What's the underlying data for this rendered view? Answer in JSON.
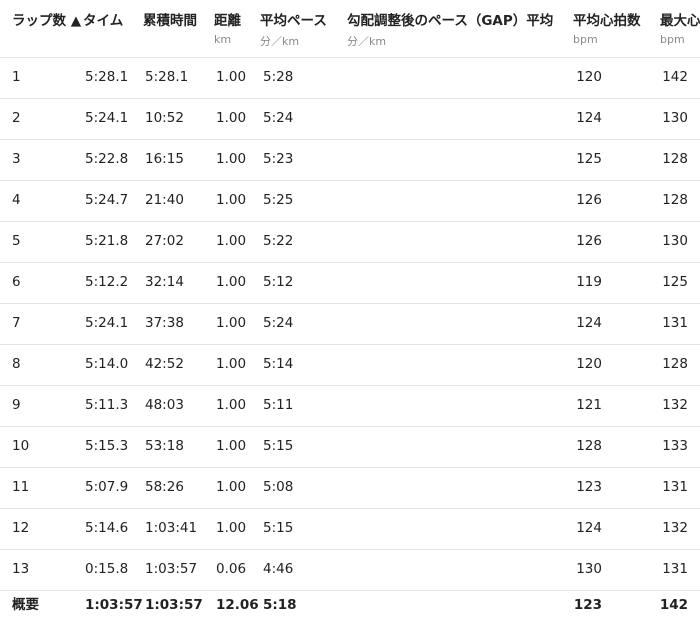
{
  "headers": [
    {
      "label": "ラップ数 ▲",
      "unit": ""
    },
    {
      "label": "タイム",
      "unit": ""
    },
    {
      "label": "累積時間",
      "unit": ""
    },
    {
      "label": "距離",
      "unit": "km"
    },
    {
      "label": "平均ペース",
      "unit": "分／km"
    },
    {
      "label": "勾配調整後のペース（GAP）平均",
      "unit": "分／km"
    },
    {
      "label": "平均心拍数",
      "unit": "bpm"
    },
    {
      "label": "最大心",
      "unit": "bpm"
    }
  ],
  "rows": [
    {
      "lap": "1",
      "time": "5:28.1",
      "cumulative": "5:28.1",
      "distance": "1.00",
      "pace": "5:28",
      "gap": "",
      "avg_hr": "120",
      "max_hr": "142"
    },
    {
      "lap": "2",
      "time": "5:24.1",
      "cumulative": "10:52",
      "distance": "1.00",
      "pace": "5:24",
      "gap": "",
      "avg_hr": "124",
      "max_hr": "130"
    },
    {
      "lap": "3",
      "time": "5:22.8",
      "cumulative": "16:15",
      "distance": "1.00",
      "pace": "5:23",
      "gap": "",
      "avg_hr": "125",
      "max_hr": "128"
    },
    {
      "lap": "4",
      "time": "5:24.7",
      "cumulative": "21:40",
      "distance": "1.00",
      "pace": "5:25",
      "gap": "",
      "avg_hr": "126",
      "max_hr": "128"
    },
    {
      "lap": "5",
      "time": "5:21.8",
      "cumulative": "27:02",
      "distance": "1.00",
      "pace": "5:22",
      "gap": "",
      "avg_hr": "126",
      "max_hr": "130"
    },
    {
      "lap": "6",
      "time": "5:12.2",
      "cumulative": "32:14",
      "distance": "1.00",
      "pace": "5:12",
      "gap": "",
      "avg_hr": "119",
      "max_hr": "125"
    },
    {
      "lap": "7",
      "time": "5:24.1",
      "cumulative": "37:38",
      "distance": "1.00",
      "pace": "5:24",
      "gap": "",
      "avg_hr": "124",
      "max_hr": "131"
    },
    {
      "lap": "8",
      "time": "5:14.0",
      "cumulative": "42:52",
      "distance": "1.00",
      "pace": "5:14",
      "gap": "",
      "avg_hr": "120",
      "max_hr": "128"
    },
    {
      "lap": "9",
      "time": "5:11.3",
      "cumulative": "48:03",
      "distance": "1.00",
      "pace": "5:11",
      "gap": "",
      "avg_hr": "121",
      "max_hr": "132"
    },
    {
      "lap": "10",
      "time": "5:15.3",
      "cumulative": "53:18",
      "distance": "1.00",
      "pace": "5:15",
      "gap": "",
      "avg_hr": "128",
      "max_hr": "133"
    },
    {
      "lap": "11",
      "time": "5:07.9",
      "cumulative": "58:26",
      "distance": "1.00",
      "pace": "5:08",
      "gap": "",
      "avg_hr": "123",
      "max_hr": "131"
    },
    {
      "lap": "12",
      "time": "5:14.6",
      "cumulative": "1:03:41",
      "distance": "1.00",
      "pace": "5:15",
      "gap": "",
      "avg_hr": "124",
      "max_hr": "132"
    },
    {
      "lap": "13",
      "time": "0:15.8",
      "cumulative": "1:03:57",
      "distance": "0.06",
      "pace": "4:46",
      "gap": "",
      "avg_hr": "130",
      "max_hr": "131"
    }
  ],
  "summary": {
    "lap": "概要",
    "time": "1:03:57",
    "cumulative": "1:03:57",
    "distance": "12.06",
    "pace": "5:18",
    "gap": "",
    "avg_hr": "123",
    "max_hr": "142"
  }
}
